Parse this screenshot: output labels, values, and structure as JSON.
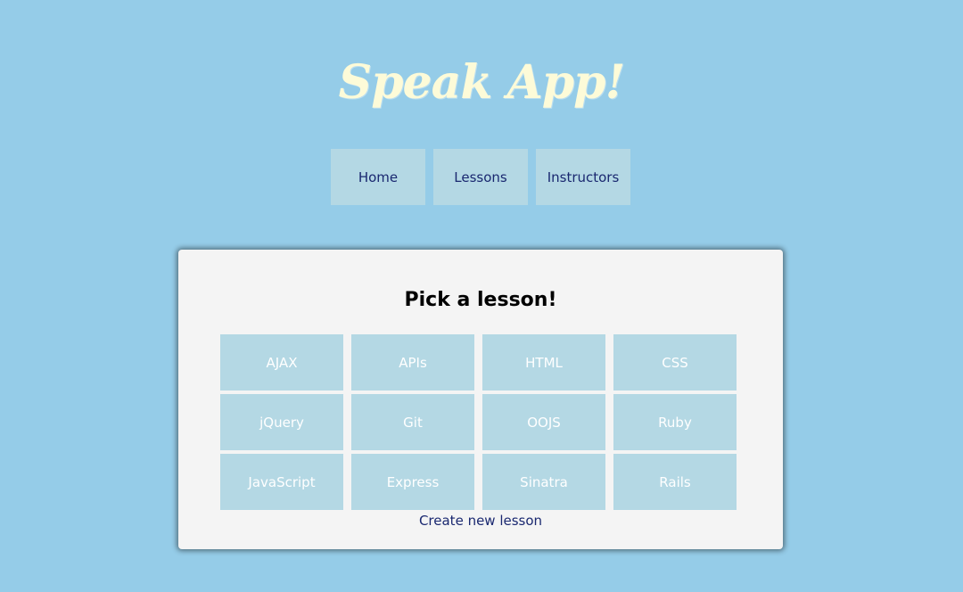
{
  "header": {
    "logo": "Speak App!"
  },
  "nav": {
    "items": [
      {
        "label": "Home"
      },
      {
        "label": "Lessons"
      },
      {
        "label": "Instructors"
      }
    ]
  },
  "main": {
    "title": "Pick a lesson!",
    "lessons": [
      {
        "label": "AJAX"
      },
      {
        "label": "APIs"
      },
      {
        "label": "HTML"
      },
      {
        "label": "CSS"
      },
      {
        "label": "jQuery"
      },
      {
        "label": "Git"
      },
      {
        "label": "OOJS"
      },
      {
        "label": "Ruby"
      },
      {
        "label": "JavaScript"
      },
      {
        "label": "Express"
      },
      {
        "label": "Sinatra"
      },
      {
        "label": "Rails"
      }
    ],
    "create_link": "Create new lesson"
  },
  "colors": {
    "background": "#95cce8",
    "logo": "#fdfbd8",
    "button": "#b4d8e4",
    "nav_text": "#1a2870",
    "card": "#f4f4f4",
    "lesson_text": "#ffffff"
  }
}
